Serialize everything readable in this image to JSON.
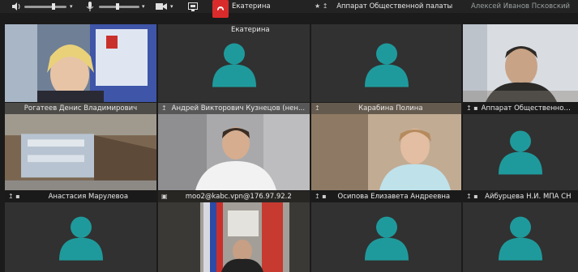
{
  "toolbar": {
    "speaker_icon": "speaker-icon",
    "mic_icon": "microphone-icon",
    "camera_icon": "camera-icon",
    "screen_icon": "screen-share-icon",
    "hangup_icon": "hangup-icon",
    "speaker_level": 0.7,
    "mic_level": 0.45
  },
  "tiles": [
    {
      "name": "Екатерина",
      "icon": ""
    },
    {
      "name": "Аппарат Общественной палаты",
      "icon": "★ ↥"
    },
    {
      "name": "Алексей Иванов Псковский",
      "icon": ""
    },
    {
      "name": "Рогатеев Денис Владимирович",
      "icon": ""
    },
    {
      "name": "Андрей Викторович Кузнецов (нен...",
      "icon": "↥"
    },
    {
      "name": "Карабина Полина",
      "icon": "↥"
    },
    {
      "name": "Аппарат Общественной п",
      "icon": "↥ ▪"
    },
    {
      "name": "Анастасия Марулевоа",
      "icon": "↥ ▪"
    },
    {
      "name": "moo2@kabc.vpn@176.97.92.2",
      "icon": "▣"
    },
    {
      "name": "Осипова Елизавета Андреевна",
      "icon": "↥ ▪"
    },
    {
      "name": "Айбурцева Н.И. МПА СН",
      "icon": "↥ ▪"
    }
  ],
  "colors": {
    "avatar": "#1f9a9c",
    "tile_bg": "#313131",
    "active_border": "#1fa89a",
    "hangup": "#d92b2b"
  }
}
